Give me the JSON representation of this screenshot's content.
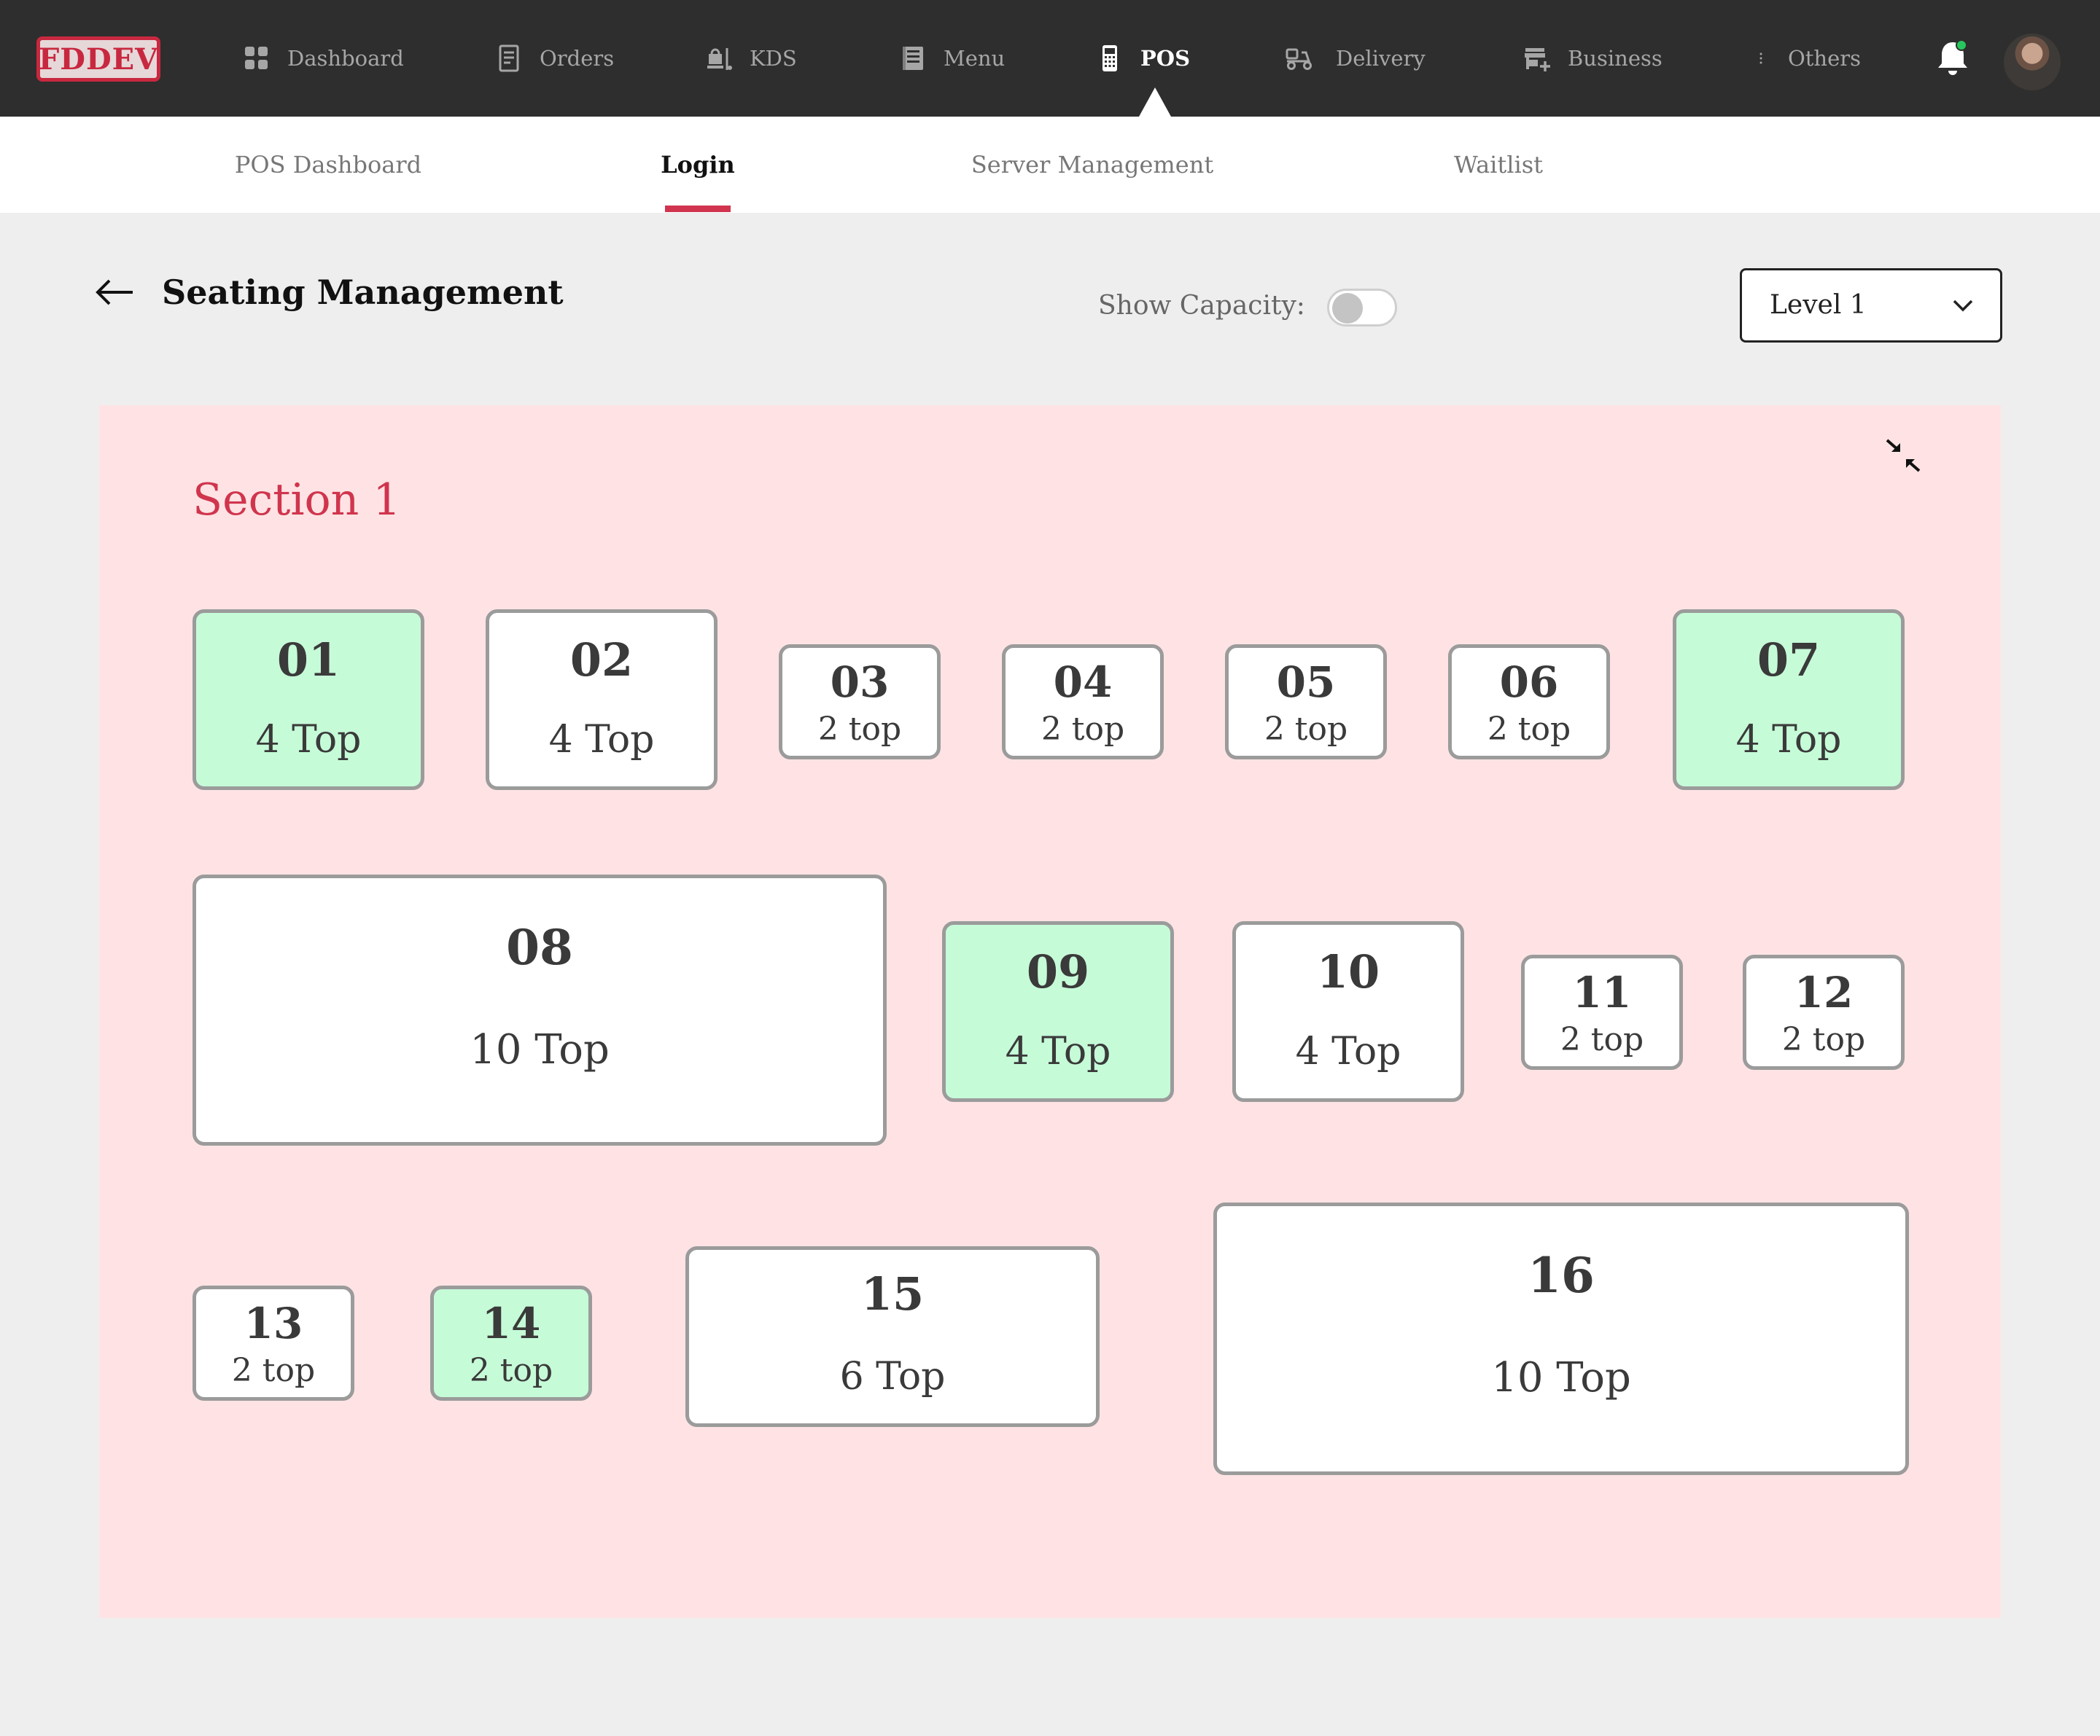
{
  "brand": {
    "logo_text": "FDDEV"
  },
  "nav": {
    "items": [
      {
        "label": "Dashboard",
        "icon": "grid-icon"
      },
      {
        "label": "Orders",
        "icon": "receipt-icon"
      },
      {
        "label": "KDS",
        "icon": "kitchen-icon"
      },
      {
        "label": "Menu",
        "icon": "book-icon"
      },
      {
        "label": "POS",
        "icon": "pos-terminal-icon",
        "active": true
      },
      {
        "label": "Delivery",
        "icon": "delivery-scooter-icon"
      },
      {
        "label": "Business",
        "icon": "store-add-icon"
      },
      {
        "label": "Others",
        "icon": "more-vertical-icon"
      }
    ],
    "notification_icon": "bell-icon",
    "notification_dot_color": "#26c75d"
  },
  "subnav": {
    "tabs": [
      {
        "label": "POS Dashboard"
      },
      {
        "label": "Login",
        "active": true
      },
      {
        "label": "Server Management"
      },
      {
        "label": "Waitlist"
      }
    ],
    "accent_color": "#d1344f"
  },
  "header": {
    "title": "Seating Management",
    "show_capacity_label": "Show Capacity:",
    "show_capacity_on": false,
    "level_selected": "Level 1"
  },
  "section": {
    "title": "Section 1",
    "color": "#d0354d",
    "background": "#ffe3e4"
  },
  "tables": [
    {
      "number": "01",
      "capacity": "4 Top",
      "occupied": true
    },
    {
      "number": "02",
      "capacity": "4 Top",
      "occupied": false
    },
    {
      "number": "03",
      "capacity": "2 top",
      "occupied": false
    },
    {
      "number": "04",
      "capacity": "2 top",
      "occupied": false
    },
    {
      "number": "05",
      "capacity": "2 top",
      "occupied": false
    },
    {
      "number": "06",
      "capacity": "2 top",
      "occupied": false
    },
    {
      "number": "07",
      "capacity": "4 Top",
      "occupied": true
    },
    {
      "number": "08",
      "capacity": "10 Top",
      "occupied": false
    },
    {
      "number": "09",
      "capacity": "4 Top",
      "occupied": true
    },
    {
      "number": "10",
      "capacity": "4 Top",
      "occupied": false
    },
    {
      "number": "11",
      "capacity": "2 top",
      "occupied": false
    },
    {
      "number": "12",
      "capacity": "2 top",
      "occupied": false
    },
    {
      "number": "13",
      "capacity": "2 top",
      "occupied": false
    },
    {
      "number": "14",
      "capacity": "2 top",
      "occupied": true
    },
    {
      "number": "15",
      "capacity": "6 Top",
      "occupied": false
    },
    {
      "number": "16",
      "capacity": "10 Top",
      "occupied": false
    }
  ],
  "colors": {
    "occupied_fill": "#c6fbd8",
    "free_fill": "#ffffff",
    "table_border": "#9b9b9b"
  }
}
